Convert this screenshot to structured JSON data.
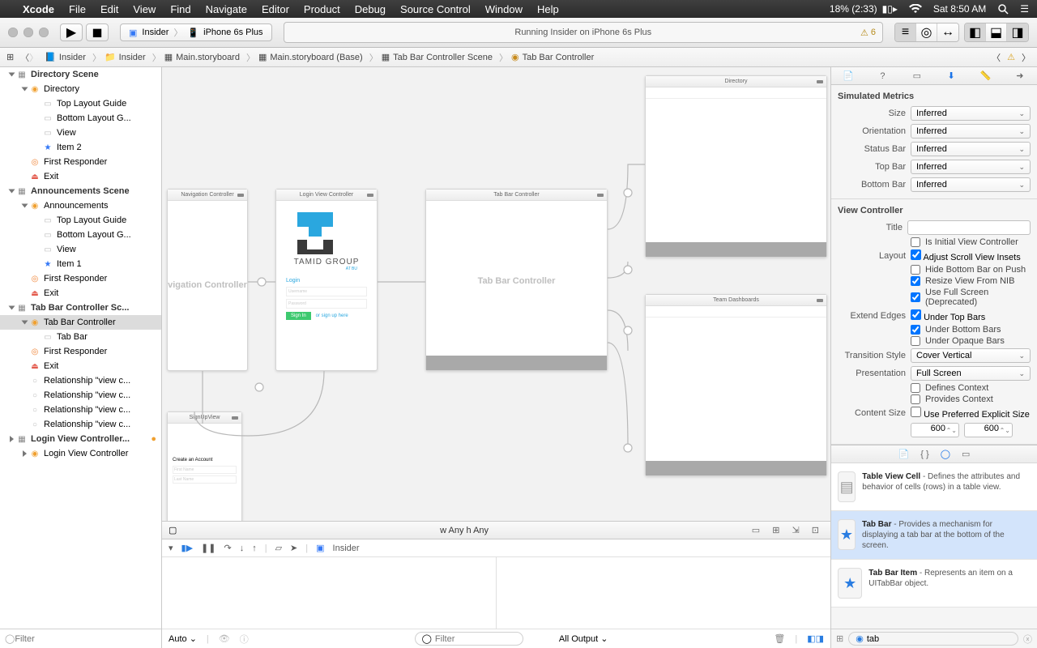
{
  "menubar": {
    "app": "Xcode",
    "items": [
      "File",
      "Edit",
      "View",
      "Find",
      "Navigate",
      "Editor",
      "Product",
      "Debug",
      "Source Control",
      "Window",
      "Help"
    ],
    "battery": "18% (2:33)",
    "clock": "Sat 8:50 AM"
  },
  "toolbar": {
    "scheme_target": "Insider",
    "scheme_device": "iPhone 6s Plus",
    "activity": "Running Insider on iPhone 6s Plus",
    "warning_count": "6"
  },
  "jumpbar": {
    "crumbs": [
      "Insider",
      "Insider",
      "Main.storyboard",
      "Main.storyboard (Base)",
      "Tab Bar Controller Scene",
      "Tab Bar Controller"
    ]
  },
  "navigator": {
    "filter_placeholder": "Filter",
    "tree": [
      {
        "d": 0,
        "label": "Directory Scene",
        "kind": "scene",
        "open": true
      },
      {
        "d": 1,
        "label": "Directory",
        "kind": "vc",
        "open": true
      },
      {
        "d": 2,
        "label": "Top Layout Guide",
        "kind": "guide"
      },
      {
        "d": 2,
        "label": "Bottom Layout G...",
        "kind": "guide"
      },
      {
        "d": 2,
        "label": "View",
        "kind": "view"
      },
      {
        "d": 2,
        "label": "Item 2",
        "kind": "item"
      },
      {
        "d": 1,
        "label": "First Responder",
        "kind": "fr"
      },
      {
        "d": 1,
        "label": "Exit",
        "kind": "exit"
      },
      {
        "d": 0,
        "label": "Announcements Scene",
        "kind": "scene",
        "open": true
      },
      {
        "d": 1,
        "label": "Announcements",
        "kind": "vc",
        "open": true
      },
      {
        "d": 2,
        "label": "Top Layout Guide",
        "kind": "guide"
      },
      {
        "d": 2,
        "label": "Bottom Layout G...",
        "kind": "guide"
      },
      {
        "d": 2,
        "label": "View",
        "kind": "view"
      },
      {
        "d": 2,
        "label": "Item 1",
        "kind": "item"
      },
      {
        "d": 1,
        "label": "First Responder",
        "kind": "fr"
      },
      {
        "d": 1,
        "label": "Exit",
        "kind": "exit"
      },
      {
        "d": 0,
        "label": "Tab Bar Controller Sc...",
        "kind": "scene",
        "open": true
      },
      {
        "d": 1,
        "label": "Tab Bar Controller",
        "kind": "vc",
        "open": true,
        "selected": true
      },
      {
        "d": 2,
        "label": "Tab Bar",
        "kind": "view"
      },
      {
        "d": 1,
        "label": "First Responder",
        "kind": "fr"
      },
      {
        "d": 1,
        "label": "Exit",
        "kind": "exit"
      },
      {
        "d": 1,
        "label": "Relationship \"view c...",
        "kind": "segue"
      },
      {
        "d": 1,
        "label": "Relationship \"view c...",
        "kind": "segue"
      },
      {
        "d": 1,
        "label": "Relationship \"view c...",
        "kind": "segue"
      },
      {
        "d": 1,
        "label": "Relationship \"view c...",
        "kind": "segue"
      },
      {
        "d": 0,
        "label": "Login View Controller...",
        "kind": "scene",
        "highlight": true
      },
      {
        "d": 1,
        "label": "Login View Controller",
        "kind": "vc"
      }
    ]
  },
  "canvas": {
    "size_hint": "w Any  h Any",
    "vcs": {
      "nav": {
        "title": "Navigation Controller",
        "body": "vigation Controller"
      },
      "login": {
        "title": "Login View Controller",
        "brand1": "TAMID",
        "brand2": " GROUP",
        "brand3": "AT BU",
        "login_label": "Login",
        "uname": "Username",
        "pword": "Password",
        "signin": "Sign In",
        "signup": "or sign up here"
      },
      "signup": {
        "title": "SignUpView",
        "create": "Create an Account",
        "fn": "First Name",
        "ln": "Last Name"
      },
      "tabbar": {
        "title": "Tab Bar Controller",
        "body": "Tab Bar Controller"
      },
      "directory": {
        "title": "Directory"
      },
      "team": {
        "title": "Team Dashboards"
      }
    }
  },
  "console": {
    "target": "Insider",
    "auto": "Auto",
    "filter_placeholder": "Filter",
    "alloutput": "All Output"
  },
  "inspector": {
    "sim": {
      "header": "Simulated Metrics",
      "size_label": "Size",
      "size": "Inferred",
      "orientation_label": "Orientation",
      "orientation": "Inferred",
      "status_label": "Status Bar",
      "status": "Inferred",
      "top_label": "Top Bar",
      "top": "Inferred",
      "bottom_label": "Bottom Bar",
      "bottom": "Inferred"
    },
    "vc": {
      "header": "View Controller",
      "title_label": "Title",
      "title": "",
      "initial": "Is Initial View Controller",
      "layout_label": "Layout",
      "adjust": "Adjust Scroll View Insets",
      "hide": "Hide Bottom Bar on Push",
      "resize": "Resize View From NIB",
      "usefull": "Use Full Screen (Deprecated)",
      "edges_label": "Extend Edges",
      "under_top": "Under Top Bars",
      "under_bottom": "Under Bottom Bars",
      "under_opaque": "Under Opaque Bars",
      "trans_label": "Transition Style",
      "trans": "Cover Vertical",
      "pres_label": "Presentation",
      "pres": "Full Screen",
      "defines": "Defines Context",
      "provides": "Provides Context",
      "cs_label": "Content Size",
      "csuse": "Use Preferred Explicit Size",
      "csw": "600",
      "csh": "600"
    }
  },
  "library": {
    "items": [
      {
        "name": "Table View Cell",
        "desc": " - Defines the attributes and behavior of cells (rows) in a table view."
      },
      {
        "name": "Tab Bar",
        "desc": " - Provides a mechanism for displaying a tab bar at the bottom of the screen.",
        "selected": true
      },
      {
        "name": "Tab Bar Item",
        "desc": " - Represents an item on a UITabBar object."
      }
    ],
    "filter_value": "tab"
  }
}
